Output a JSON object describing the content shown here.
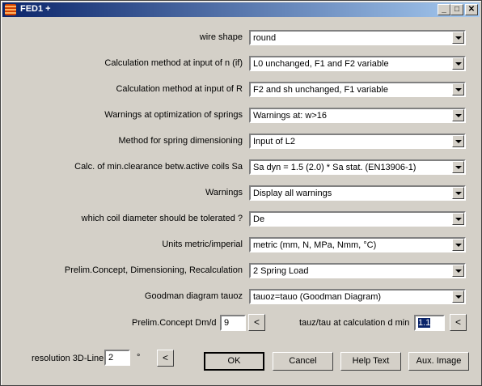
{
  "window": {
    "title": "FED1 +",
    "minimize": "_",
    "maximize": "□",
    "close": "✕"
  },
  "rows": [
    {
      "label": "wire shape",
      "value": "round"
    },
    {
      "label": "Calculation method at input of n (if)",
      "value": "L0 unchanged, F1 and F2 variable"
    },
    {
      "label": "Calculation method at input of R",
      "value": "F2 and sh unchanged, F1 variable"
    },
    {
      "label": "Warnings at optimization of springs",
      "value": "Warnings at: w>16"
    },
    {
      "label": "Method for spring dimensioning",
      "value": "Input of L2"
    },
    {
      "label": "Calc. of min.clearance betw.active coils Sa",
      "value": "Sa dyn = 1.5 (2.0) * Sa stat. (EN13906-1)"
    },
    {
      "label": "Warnings",
      "value": "Display all warnings"
    },
    {
      "label": "which coil diameter should be tolerated ?",
      "value": "De"
    },
    {
      "label": "Units metric/imperial",
      "value": "metric (mm, N, MPa, Nmm, °C)"
    },
    {
      "label": "Prelim.Concept, Dimensioning, Recalculation",
      "value": "2 Spring Load"
    },
    {
      "label": "Goodman diagram tauoz",
      "value": "tauoz=tauo (Goodman Diagram)"
    }
  ],
  "dmd": {
    "label": "Prelim.Concept Dm/d",
    "value": "9",
    "button": "<"
  },
  "tau": {
    "label": "tauz/tau at calculation d min",
    "value": "1.1",
    "button": "<"
  },
  "resolution": {
    "label": "resolution 3D-Line",
    "value": "2",
    "unit": "°",
    "button": "<"
  },
  "buttons": {
    "ok": "OK",
    "cancel": "Cancel",
    "help": "Help Text",
    "aux": "Aux. Image"
  }
}
